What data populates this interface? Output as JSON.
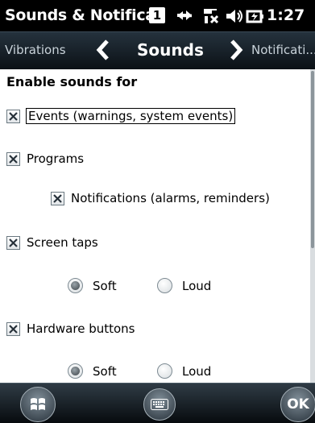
{
  "titlebar": {
    "title": "Sounds & Notifica",
    "sim_indicator": "1",
    "clock": "1:27",
    "icons": [
      "sim-slot-icon",
      "data-connection-icon",
      "signal-off-icon",
      "speaker-icon",
      "battery-charging-icon"
    ]
  },
  "tabs": {
    "previous": "Vibrations",
    "current": "Sounds",
    "next": "Notificati..."
  },
  "content": {
    "section_title": "Enable sounds for",
    "events_label": "Events (warnings, system events)",
    "events_checked": true,
    "programs_label": "Programs",
    "programs_checked": true,
    "notifications_label": "Notifications (alarms, reminders)",
    "notifications_checked": true,
    "screen_taps_label": "Screen taps",
    "screen_taps_checked": true,
    "screen_taps_soft_label": "Soft",
    "screen_taps_loud_label": "Loud",
    "screen_taps_selected": "Soft",
    "hardware_label": "Hardware buttons",
    "hardware_checked": true,
    "hardware_soft_label": "Soft",
    "hardware_loud_label": "Loud",
    "hardware_selected": "Soft"
  },
  "bottombar": {
    "start_icon": "windows-start-icon",
    "keyboard_icon": "keyboard-icon",
    "ok_label": "OK"
  }
}
